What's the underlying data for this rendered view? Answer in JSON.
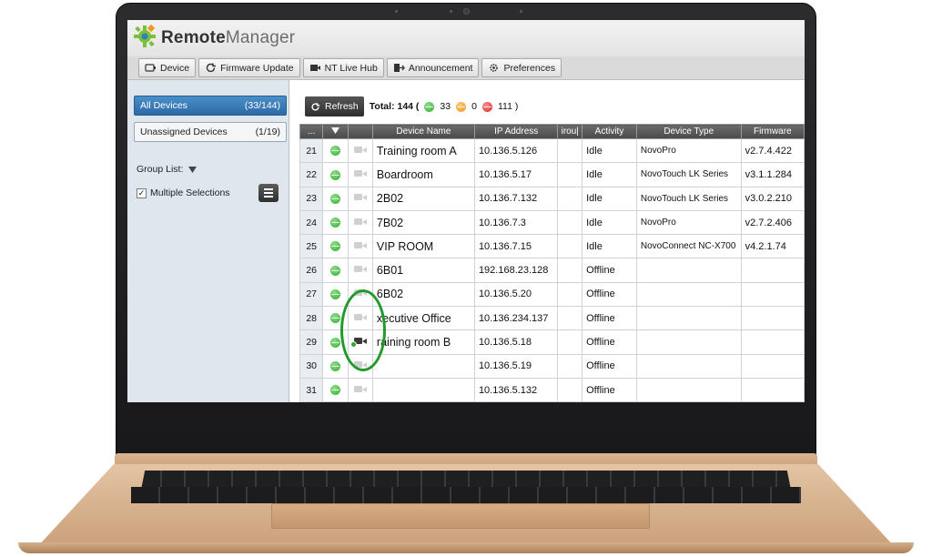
{
  "app": {
    "title_bold": "Remote",
    "title_light": "Manager"
  },
  "toolbar": {
    "device": "Device",
    "firmware_update": "Firmware Update",
    "nt_live_hub": "NT Live Hub",
    "announcement": "Announcement",
    "preferences": "Preferences"
  },
  "sidebar": {
    "all_devices_label": "All Devices",
    "all_devices_count": "(33/144)",
    "unassigned_label": "Unassigned Devices",
    "unassigned_count": "(1/19)",
    "group_list_label": "Group List:",
    "multiple_selections_label": "Multiple Selections",
    "multiple_selections_checked": true
  },
  "summary": {
    "refresh_label": "Refresh",
    "total_label": "Total: 144 (",
    "green_count": "33",
    "orange_count": "0",
    "red_count": "111 )"
  },
  "table": {
    "columns": [
      "...",
      "",
      "",
      "Device Name",
      "IP Address",
      "irou|",
      "Activity",
      "Device Type",
      "Firmware"
    ],
    "rows": [
      {
        "num": "21",
        "name": "Training room A",
        "ip": "10.136.5.126",
        "activity": "Idle",
        "type": "NovoPro",
        "firmware": "v2.7.4.422"
      },
      {
        "num": "22",
        "name": "Boardroom",
        "ip": "10.136.5.17",
        "activity": "Idle",
        "type": "NovoTouch LK Series",
        "firmware": "v3.1.1.284"
      },
      {
        "num": "23",
        "name": "2B02",
        "ip": "10.136.7.132",
        "activity": "Idle",
        "type": "NovoTouch LK Series",
        "firmware": "v3.0.2.210"
      },
      {
        "num": "24",
        "name": "7B02",
        "ip": "10.136.7.3",
        "activity": "Idle",
        "type": "NovoPro",
        "firmware": "v2.7.2.406"
      },
      {
        "num": "25",
        "name": "VIP ROOM",
        "ip": "10.136.7.15",
        "activity": "Idle",
        "type": "NovoConnect NC-X700",
        "firmware": "v4.2.1.74"
      },
      {
        "num": "26",
        "name": "6B01",
        "ip": "192.168.23.128",
        "activity": "Offline",
        "type": "",
        "firmware": ""
      },
      {
        "num": "27",
        "name": "6B02",
        "ip": "10.136.5.20",
        "activity": "Offline",
        "type": "",
        "firmware": ""
      },
      {
        "num": "28",
        "name": "xecutive Office",
        "ip": "10.136.234.137",
        "activity": "Offline",
        "type": "",
        "firmware": ""
      },
      {
        "num": "29",
        "name": "raining room B",
        "ip": "10.136.5.18",
        "activity": "Offline",
        "type": "",
        "firmware": "",
        "live": true
      },
      {
        "num": "30",
        "name": "",
        "ip": "10.136.5.19",
        "activity": "Offline",
        "type": "",
        "firmware": ""
      },
      {
        "num": "31",
        "name": "",
        "ip": "10.136.5.132",
        "activity": "Offline",
        "type": "",
        "firmware": ""
      }
    ]
  },
  "colors": {
    "accent_blue": "#2d6aa6",
    "status_green": "#2faa2c",
    "highlight_ring": "#229a2b"
  }
}
